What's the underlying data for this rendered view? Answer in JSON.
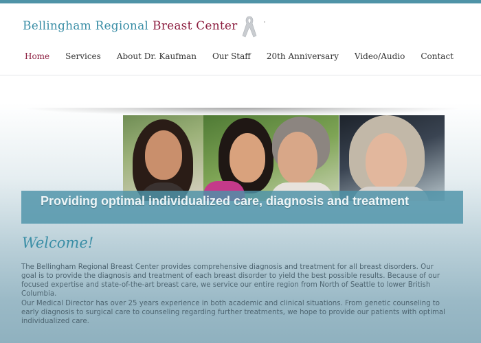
{
  "header": {
    "logo_part1": "Bellingham Regional",
    "logo_part2": "Breast Center"
  },
  "nav": {
    "items": [
      {
        "label": "Home",
        "active": true
      },
      {
        "label": "Services"
      },
      {
        "label": "About Dr. Kaufman"
      },
      {
        "label": "Our Staff"
      },
      {
        "label": "20th Anniversary"
      },
      {
        "label": "Video/Audio"
      },
      {
        "label": "Contact"
      }
    ]
  },
  "hero": {
    "banner": "Providing optimal individualized care, diagnosis and treatment"
  },
  "main": {
    "welcome": "Welcome!",
    "paragraph1": "The Bellingham Regional Breast Center provides comprehensive diagnosis and treatment for all breast disorders. Our goal is to provide the diagnosis and treatment of each breast disorder to yield the best possible results. Because of our focused expertise and state-of-the-art breast care, we service our entire region from North of Seattle to lower British Columbia.",
    "paragraph2": "Our Medical Director has over 25 years experience in both academic and clinical situations. From genetic counseling to early diagnosis to surgical care to counseling regarding further treatments, we hope to provide our patients with optimal individualized care."
  },
  "colors": {
    "accent": "#3a8ea6",
    "brand": "#8c1d3f",
    "banner": "#4d92a8"
  },
  "icons": [
    "pink-ribbon-icon"
  ]
}
